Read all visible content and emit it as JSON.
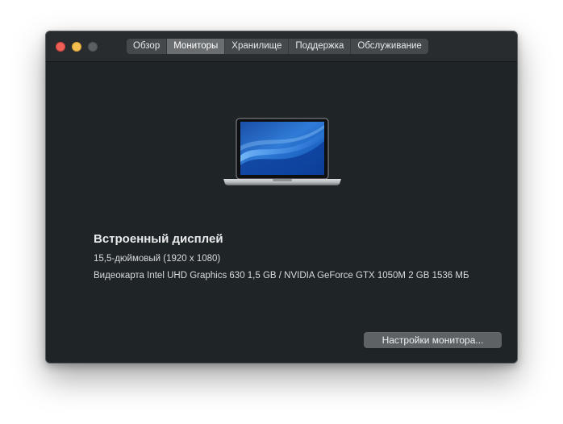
{
  "window": {
    "traffic_lights": [
      "close",
      "minimize",
      "zoom"
    ]
  },
  "tabs": [
    {
      "label": "Обзор",
      "selected": false
    },
    {
      "label": "Мониторы",
      "selected": true
    },
    {
      "label": "Хранилище",
      "selected": false
    },
    {
      "label": "Поддержка",
      "selected": false
    },
    {
      "label": "Обслуживание",
      "selected": false
    }
  ],
  "display": {
    "icon": "macbook-pro-laptop-icon",
    "title": "Встроенный дисплей",
    "size": "15,5-дюймовый (1920 x 1080)",
    "graphics": "Видеокарта Intel UHD Graphics 630 1,5 GB / NVIDIA GeForce GTX 1050M 2 GB 1536 МБ"
  },
  "buttons": {
    "monitor_settings": "Настройки монитора..."
  },
  "colors": {
    "window_bg": "#1f2427",
    "titlebar_bg": "#282c2f",
    "close": "#ed5e57",
    "minimize": "#f4be4f",
    "zoom_inactive": "#5b5f62",
    "selected_tab": "#6a6e71"
  }
}
